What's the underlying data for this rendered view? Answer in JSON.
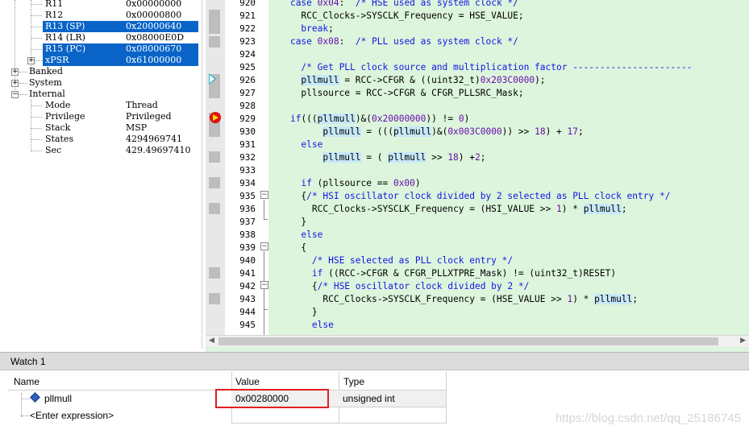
{
  "registers": [
    {
      "name": "R11",
      "value": "0x00000000",
      "selected": false
    },
    {
      "name": "R12",
      "value": "0x00000800",
      "selected": false
    },
    {
      "name": "R13 (SP)",
      "value": "0x20000640",
      "selected": true
    },
    {
      "name": "R14 (LR)",
      "value": "0x08000E0D",
      "selected": false
    },
    {
      "name": "R15 (PC)",
      "value": "0x08000670",
      "selected": true
    },
    {
      "name": "xPSR",
      "value": "0x61000000",
      "selected": true
    }
  ],
  "groups": [
    "Banked",
    "System",
    "Internal"
  ],
  "internal": [
    {
      "name": "Mode",
      "value": "Thread"
    },
    {
      "name": "Privilege",
      "value": "Privileged"
    },
    {
      "name": "Stack",
      "value": "MSP"
    },
    {
      "name": "States",
      "value": "4294969741"
    },
    {
      "name": "Sec",
      "value": "429.49697410"
    }
  ],
  "code_lines": [
    {
      "n": "920",
      "t": "    case 0x04:  /* HSE used as system clock */"
    },
    {
      "n": "921",
      "t": "      RCC_Clocks->SYSCLK_Frequency = HSE_VALUE;"
    },
    {
      "n": "922",
      "t": "      break;"
    },
    {
      "n": "923",
      "t": "    case 0x08:  /* PLL used as system clock */"
    },
    {
      "n": "924",
      "t": ""
    },
    {
      "n": "925",
      "t": "      /* Get PLL clock source and multiplication factor ----------------------"
    },
    {
      "n": "926",
      "t": "      pllmull = RCC->CFGR & ((uint32_t)0x203C0000);"
    },
    {
      "n": "927",
      "t": "      pllsource = RCC->CFGR & CFGR_PLLSRC_Mask;"
    },
    {
      "n": "928",
      "t": ""
    },
    {
      "n": "929",
      "t": "    if(((pllmull)&(0x20000000)) != 0)"
    },
    {
      "n": "930",
      "t": "          pllmull = (((pllmull)&(0x003C0000)) >> 18) + 17;"
    },
    {
      "n": "931",
      "t": "      else"
    },
    {
      "n": "932",
      "t": "          pllmull = ( pllmull >> 18) +2;"
    },
    {
      "n": "933",
      "t": ""
    },
    {
      "n": "934",
      "t": "      if (pllsource == 0x00)"
    },
    {
      "n": "935",
      "t": "      {/* HSI oscillator clock divided by 2 selected as PLL clock entry */"
    },
    {
      "n": "936",
      "t": "        RCC_Clocks->SYSCLK_Frequency = (HSI_VALUE >> 1) * pllmull;"
    },
    {
      "n": "937",
      "t": "      }"
    },
    {
      "n": "938",
      "t": "      else"
    },
    {
      "n": "939",
      "t": "      {"
    },
    {
      "n": "940",
      "t": "        /* HSE selected as PLL clock entry */"
    },
    {
      "n": "941",
      "t": "        if ((RCC->CFGR & CFGR_PLLXTPRE_Mask) != (uint32_t)RESET)"
    },
    {
      "n": "942",
      "t": "        {/* HSE oscillator clock divided by 2 */"
    },
    {
      "n": "943",
      "t": "          RCC_Clocks->SYSCLK_Frequency = (HSE_VALUE >> 1) * pllmull;"
    },
    {
      "n": "944",
      "t": "        }"
    },
    {
      "n": "945",
      "t": "        else"
    }
  ],
  "watch": {
    "title": "Watch 1",
    "columns": {
      "name": "Name",
      "value": "Value",
      "type": "Type"
    },
    "rows": [
      {
        "name": "pllmull",
        "value": "0x00280000",
        "type": "unsigned int"
      }
    ],
    "enter_expression": "<Enter expression>"
  },
  "watermark": "https://blog.csdn.net/qq_25186745",
  "colors": {
    "code_bg": "#dcf5dc",
    "selection": "#0a64c8",
    "keyword": "#1515e6",
    "highlight_box": "#e02020"
  }
}
